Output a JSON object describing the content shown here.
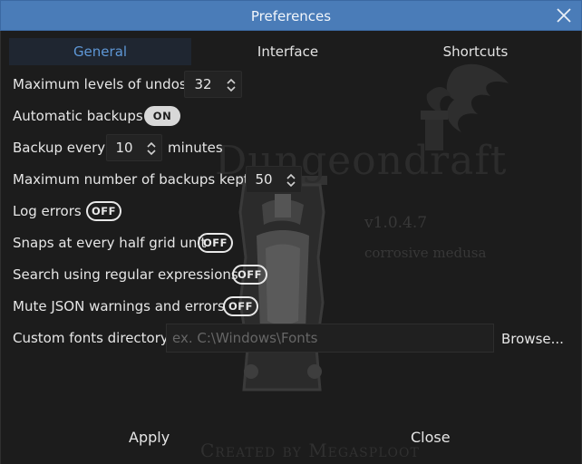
{
  "window": {
    "title": "Preferences",
    "close_icon": "close-icon"
  },
  "background": {
    "logo_text": "Dungeondraft",
    "version": "v1.0.4.7",
    "codename": "corrosive medusa",
    "credit": "Created by Megasploot"
  },
  "tabs": [
    {
      "label": "General",
      "active": true
    },
    {
      "label": "Interface",
      "active": false
    },
    {
      "label": "Shortcuts",
      "active": false
    }
  ],
  "settings": {
    "max_undos": {
      "label": "Maximum levels of undos",
      "value": "32"
    },
    "auto_backups": {
      "label": "Automatic backups",
      "state": "ON"
    },
    "backup_every": {
      "label": "Backup every",
      "value": "10",
      "suffix": "minutes"
    },
    "max_backups": {
      "label": "Maximum number of backups kept",
      "value": "50"
    },
    "log_errors": {
      "label": "Log errors",
      "state": "OFF"
    },
    "snaps_half_grid": {
      "label": "Snaps at every half grid unit",
      "state": "OFF"
    },
    "regex_search": {
      "label": "Search using regular expressions",
      "state": "OFF"
    },
    "mute_json": {
      "label": "Mute JSON warnings and errors",
      "state": "OFF"
    },
    "fonts_dir": {
      "label": "Custom fonts directory",
      "placeholder": "ex. C:\\Windows\\Fonts",
      "value": "",
      "browse_label": "Browse..."
    }
  },
  "buttons": {
    "apply": "Apply",
    "close": "Close"
  },
  "colors": {
    "titlebar": "#4a7cb8",
    "active_tab_text": "#5e97d6",
    "background": "#1c1c1c"
  }
}
